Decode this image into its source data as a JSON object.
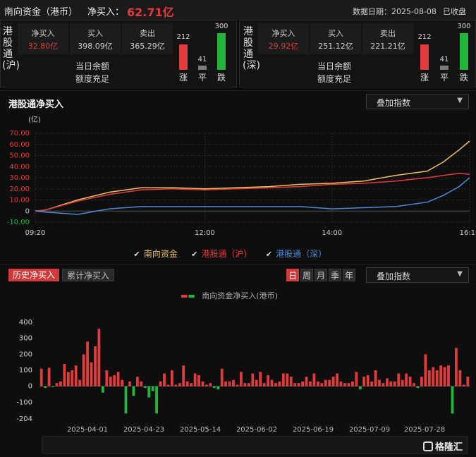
{
  "header": {
    "title": "南向资金（港币）",
    "net_label": "净买入：",
    "net_value": "62.71亿",
    "date_label": "数据日期：2025-08-08",
    "status": "已收盘"
  },
  "panels": [
    {
      "label": "港股通(沪)",
      "net_buy_label": "净买入",
      "net_buy": "32.80亿",
      "buy_label": "买入",
      "buy": "398.09亿",
      "sell_label": "卖出",
      "sell": "365.29亿",
      "quota_line1": "当日余额",
      "quota_line2": "额度充足",
      "up_count": "212",
      "flat_count": "41",
      "down_count": "300",
      "up_label": "涨",
      "flat_label": "平",
      "down_label": "跌"
    },
    {
      "label": "港股通(深)",
      "net_buy_label": "净买入",
      "net_buy": "29.92亿",
      "buy_label": "买入",
      "buy": "251.12亿",
      "sell_label": "卖出",
      "sell": "221.21亿",
      "quota_line1": "当日余额",
      "quota_line2": "额度充足",
      "up_count": "212",
      "flat_count": "41",
      "down_count": "300",
      "up_label": "涨",
      "flat_label": "平",
      "down_label": "跌"
    }
  ],
  "intraday": {
    "title": "港股通净买入",
    "dropdown": "叠加指数",
    "unit": "(亿)",
    "legend": [
      {
        "label": "南向资金",
        "color": "#f0c060"
      },
      {
        "label": "港股通（沪）",
        "color": "#e23b3b"
      },
      {
        "label": "港股通（深）",
        "color": "#4a8ad8"
      }
    ]
  },
  "history": {
    "tab_active": "历史净买入",
    "tab_inactive": "累计净买入",
    "periods": [
      "日",
      "周",
      "月",
      "季",
      "年"
    ],
    "active_period": "日",
    "dropdown": "叠加指数",
    "legend_label": "南向资金净买入(港币)",
    "logo": "格隆汇"
  },
  "colors": {
    "red": "#e23b3b",
    "green": "#22b53a",
    "yellow": "#f0c060",
    "blue": "#4a8ad8"
  },
  "chart_data": [
    {
      "type": "line",
      "ylabel": "(亿)",
      "ylim": [
        -10,
        70
      ],
      "yticks": [
        "70.00",
        "60.00",
        "50.00",
        "40.00",
        "30.00",
        "20.00",
        "10.00",
        "0",
        "-10.00"
      ],
      "xticks": [
        "09:20",
        "12:00",
        "14:00",
        "16:10"
      ],
      "series": [
        {
          "name": "南向资金",
          "color": "#f0c060",
          "x": [
            "09:20",
            "09:30",
            "10:00",
            "10:30",
            "11:00",
            "11:30",
            "12:00",
            "13:00",
            "13:30",
            "14:00",
            "14:30",
            "15:00",
            "15:30",
            "15:45",
            "16:00",
            "16:10"
          ],
          "values": [
            0,
            1,
            10,
            17,
            21,
            21,
            20,
            22,
            24,
            25,
            27,
            32,
            36,
            44,
            55,
            63
          ]
        },
        {
          "name": "港股通（沪）",
          "color": "#e23b3b",
          "x": [
            "09:20",
            "09:30",
            "10:00",
            "10:30",
            "11:00",
            "11:30",
            "12:00",
            "13:00",
            "13:30",
            "14:00",
            "14:30",
            "15:00",
            "15:30",
            "15:45",
            "16:00",
            "16:10"
          ],
          "values": [
            0,
            1,
            9,
            15,
            19,
            20,
            19,
            21,
            22,
            24,
            25,
            27,
            30,
            32,
            34,
            33
          ]
        },
        {
          "name": "港股通（深）",
          "color": "#4a8ad8",
          "x": [
            "09:20",
            "09:30",
            "10:00",
            "10:30",
            "11:00",
            "11:30",
            "12:00",
            "13:00",
            "13:30",
            "14:00",
            "14:30",
            "15:00",
            "15:30",
            "15:45",
            "16:00",
            "16:10"
          ],
          "values": [
            0,
            -1,
            -3,
            2,
            4,
            4,
            4,
            4,
            4,
            2,
            3,
            4,
            8,
            14,
            22,
            30
          ]
        }
      ]
    },
    {
      "type": "bar",
      "series": [
        {
          "name": "南向资金净买入(港币)"
        }
      ],
      "ylim": [
        -204,
        400
      ],
      "yticks": [
        "400",
        "300",
        "200",
        "100",
        "0",
        "-100",
        "-204"
      ],
      "xticks": [
        "2025-04-01",
        "2025-04-23",
        "2025-05-14",
        "2025-06-02",
        "2025-06-19",
        "2025-07-09",
        "2025-07-28"
      ],
      "values": [
        110,
        -10,
        115,
        -5,
        20,
        30,
        140,
        90,
        100,
        130,
        40,
        200,
        280,
        150,
        250,
        360,
        -40,
        100,
        60,
        70,
        90,
        40,
        -170,
        30,
        -60,
        60,
        30,
        -10,
        -70,
        -30,
        -170,
        30,
        80,
        10,
        100,
        10,
        20,
        130,
        30,
        20,
        80,
        70,
        30,
        10,
        20,
        -10,
        -20,
        110,
        30,
        30,
        40,
        10,
        90,
        20,
        20,
        80,
        40,
        90,
        20,
        70,
        40,
        20,
        30,
        80,
        80,
        60,
        20,
        20,
        30,
        60,
        30,
        80,
        30,
        20,
        40,
        40,
        60,
        80,
        30,
        20,
        20,
        30,
        90,
        -20,
        60,
        70,
        30,
        100,
        40,
        20,
        50,
        30,
        30,
        80,
        40,
        80,
        60,
        20,
        -10,
        60,
        200,
        100,
        120,
        100,
        130,
        120,
        130,
        -170,
        240,
        100,
        10,
        60
      ]
    }
  ]
}
